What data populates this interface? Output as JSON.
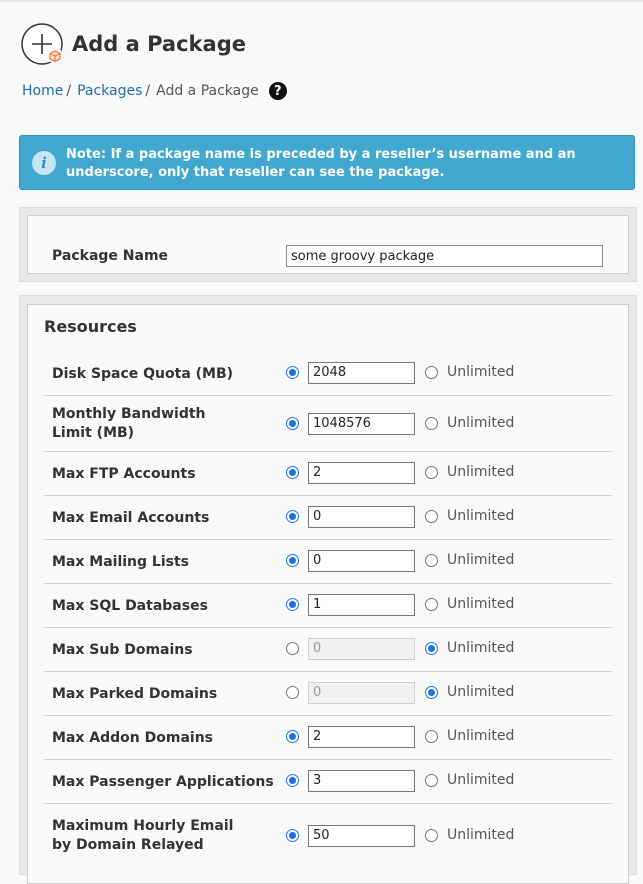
{
  "header": {
    "title": "Add a Package",
    "icon": "add-package-icon"
  },
  "breadcrumb": {
    "home": "Home",
    "packages": "Packages",
    "current": "Add a Package",
    "separator": "/"
  },
  "help_glyph": "?",
  "note": {
    "icon": "info-icon",
    "icon_glyph": "i",
    "text": "Note: If a package name is preceded by a reseller’s username and an underscore, only that reseller can see the package."
  },
  "package": {
    "label": "Package Name",
    "value": "some groovy package"
  },
  "resources": {
    "title": "Resources",
    "unlimited_label": "Unlimited",
    "rows": [
      {
        "label": "Disk Space Quota (MB)",
        "value": "2048",
        "unlimited": false
      },
      {
        "label": "Monthly Bandwidth Limit (MB)",
        "value": "1048576",
        "unlimited": false
      },
      {
        "label": "Max FTP Accounts",
        "value": "2",
        "unlimited": false
      },
      {
        "label": "Max Email Accounts",
        "value": "0",
        "unlimited": false
      },
      {
        "label": "Max Mailing Lists",
        "value": "0",
        "unlimited": false
      },
      {
        "label": "Max SQL Databases",
        "value": "1",
        "unlimited": false
      },
      {
        "label": "Max Sub Domains",
        "value": "0",
        "unlimited": true
      },
      {
        "label": "Max Parked Domains",
        "value": "0",
        "unlimited": true
      },
      {
        "label": "Max Addon Domains",
        "value": "2",
        "unlimited": false
      },
      {
        "label": "Max Passenger Applications",
        "value": "3",
        "unlimited": false
      },
      {
        "label": "Maximum Hourly Email by Domain Relayed",
        "value": "50",
        "unlimited": false
      }
    ]
  },
  "colors": {
    "accent": "#1a73e8",
    "link": "#1f6fa5",
    "note_bg": "#41a8d0"
  }
}
